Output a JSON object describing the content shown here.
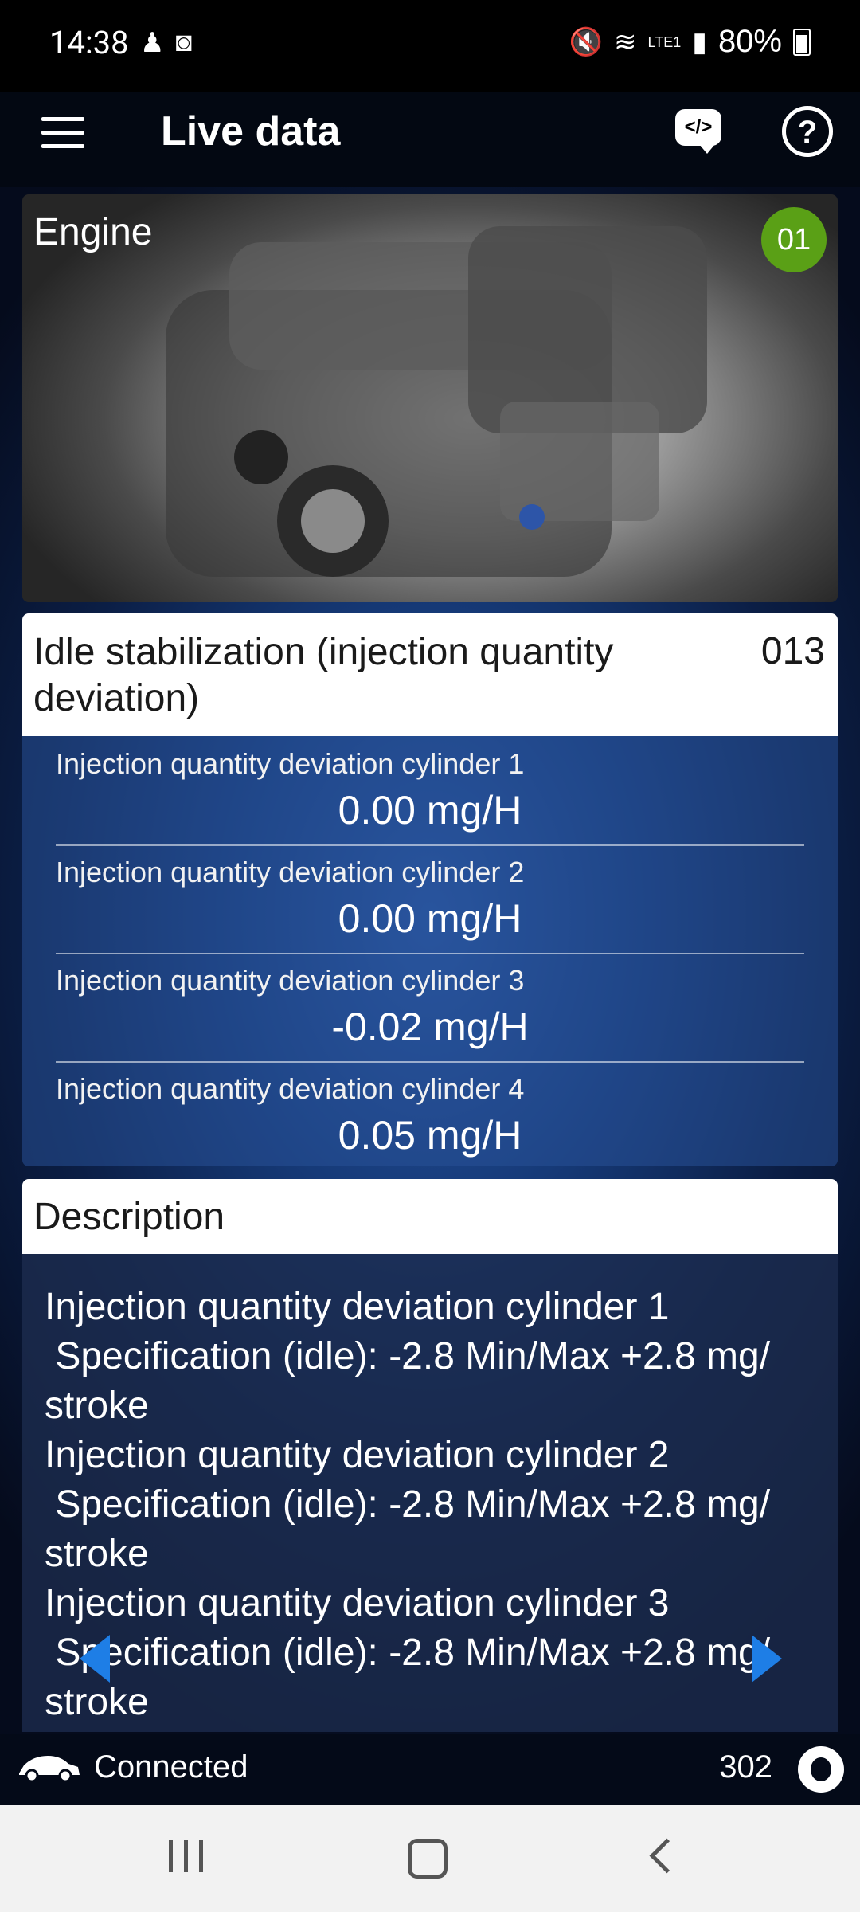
{
  "status_bar": {
    "time": "14:38",
    "battery": "80%",
    "network": "LTE1"
  },
  "app_bar": {
    "title": "Live data",
    "code_icon_text": "</>"
  },
  "engine_card": {
    "label": "Engine",
    "badge": "01"
  },
  "section": {
    "title": "Idle stabilization (injection quantity deviation)",
    "code": "013",
    "rows": [
      {
        "label": "Injection quantity deviation cylinder 1",
        "value": "0.00 mg/H"
      },
      {
        "label": "Injection quantity deviation cylinder 2",
        "value": "0.00 mg/H"
      },
      {
        "label": "Injection quantity deviation cylinder 3",
        "value": "-0.02 mg/H"
      },
      {
        "label": "Injection quantity deviation cylinder 4",
        "value": "0.05 mg/H"
      }
    ]
  },
  "description": {
    "title": "Description",
    "text": "Injection quantity deviation cylinder 1\n Specification (idle): -2.8 Min/Max +2.8 mg/\nstroke\nInjection quantity deviation cylinder 2\n Specification (idle): -2.8 Min/Max +2.8 mg/\nstroke\nInjection quantity deviation cylinder 3\n Specification (idle): -2.8 Min/Max +2.8 mg/\nstroke"
  },
  "bottom_status": {
    "connection": "Connected",
    "count": "302"
  },
  "colors": {
    "accent": "#1e7ee6",
    "badge": "#5aa016"
  }
}
